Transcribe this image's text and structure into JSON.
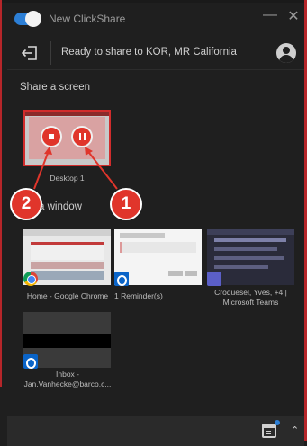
{
  "app": {
    "title": "New ClickShare",
    "toggle_on": true,
    "minimize_symbol": "—",
    "close_symbol": "✕"
  },
  "status": {
    "text": "Ready to share to KOR, MR California",
    "exit_icon": "exit-icon",
    "user_icon": "user-icon"
  },
  "screen_section": {
    "heading": "Share a screen",
    "items": [
      {
        "label": "Desktop 1",
        "selected": true
      }
    ]
  },
  "window_section": {
    "heading": "a window",
    "items": [
      {
        "label": "Home - Google Chrome",
        "app_icon": "chrome-icon"
      },
      {
        "label": "1 Reminder(s)",
        "app_icon": "outlook-icon"
      },
      {
        "label": "Croquesel, Yves, +4 | Microsoft Teams",
        "app_icon": "teams-icon"
      },
      {
        "label": "Inbox - Jan.Vanhecke@barco.c...",
        "app_icon": "outlook-icon"
      }
    ]
  },
  "callouts": [
    {
      "number": "1",
      "target": "pause-button"
    },
    {
      "number": "2",
      "target": "stop-button"
    }
  ],
  "bottom": {
    "calendar_icon": "calendar-icon",
    "expand_icon": "chevron-up-icon",
    "expand_symbol": "⌃"
  },
  "colors": {
    "background": "#1f1f1f",
    "accent": "#2c7fd6",
    "highlight": "#e0352b"
  }
}
